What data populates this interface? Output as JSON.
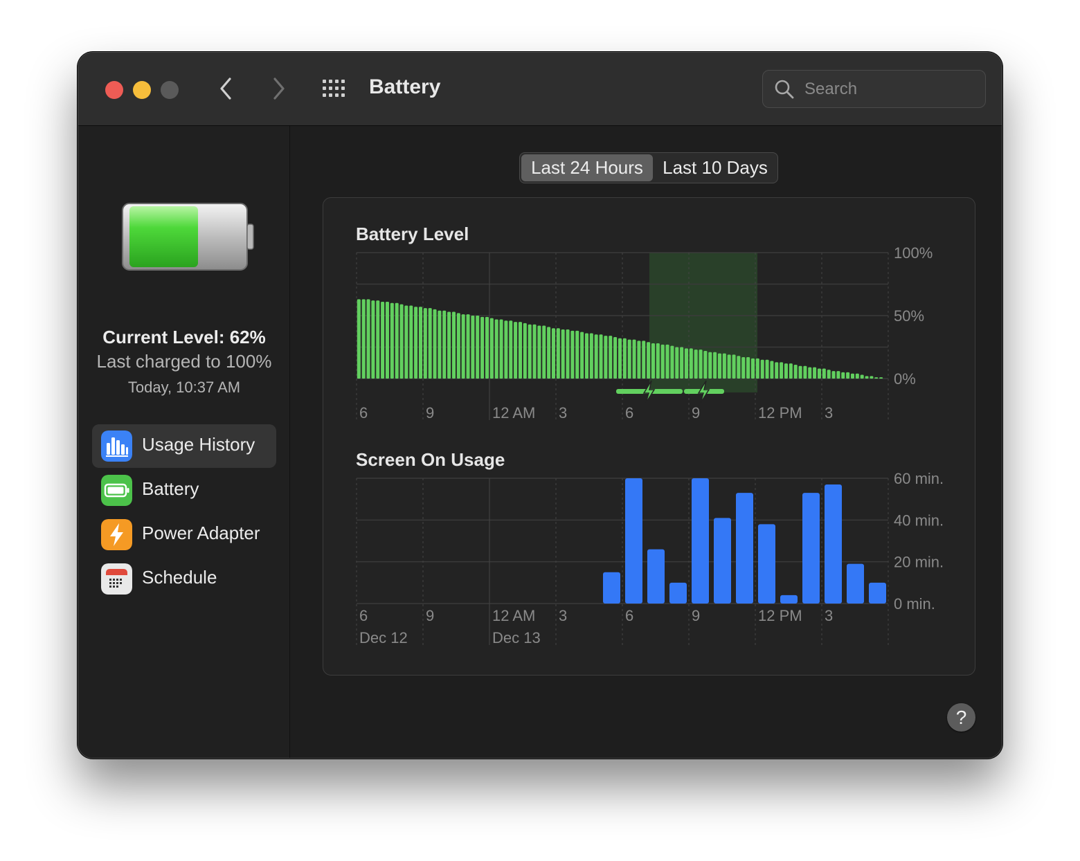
{
  "window": {
    "title": "Battery"
  },
  "search": {
    "placeholder": "Search"
  },
  "sidebar": {
    "current_level": "Current Level: 62%",
    "last_charged": "Last charged to 100%",
    "charged_time": "Today, 10:37 AM",
    "battery_fill": 0.62,
    "items": [
      {
        "label": "Usage History",
        "icon": "bar-chart-icon",
        "active": true
      },
      {
        "label": "Battery",
        "icon": "battery-icon",
        "active": false
      },
      {
        "label": "Power Adapter",
        "icon": "lightning-icon",
        "active": false
      },
      {
        "label": "Schedule",
        "icon": "calendar-icon",
        "active": false
      }
    ]
  },
  "segmented": {
    "options": [
      "Last 24 Hours",
      "Last 10 Days"
    ],
    "selected": "Last 24 Hours"
  },
  "colors": {
    "battery_bar": "#62d05f",
    "usage_bar": "#3478f6",
    "charging_band": "#2f5a30"
  },
  "help": {
    "label": "?"
  },
  "chart_data": [
    {
      "type": "bar",
      "title": "Battery Level",
      "y_ticks": [
        "100%",
        "50%",
        "0%"
      ],
      "ylim": [
        0,
        100
      ],
      "x_ticks": [
        "6",
        "9",
        "12 AM",
        "3",
        "6",
        "9",
        "12 PM",
        "3"
      ],
      "charging_periods": [
        [
          47,
          54
        ],
        [
          59,
          66
        ]
      ],
      "values": [
        63,
        63,
        63,
        63,
        62,
        62,
        62,
        61,
        61,
        61,
        61,
        60,
        60,
        60,
        59,
        59,
        59,
        58,
        58,
        58,
        57,
        57,
        57,
        56,
        56,
        56,
        55,
        55,
        55,
        54,
        54,
        54,
        53,
        53,
        53,
        52,
        52,
        52,
        51,
        51,
        51,
        50,
        50,
        50,
        49,
        49,
        49,
        48,
        48,
        48,
        47,
        47,
        47,
        46,
        46,
        46,
        45,
        45,
        45,
        44,
        44,
        44,
        43,
        43,
        43,
        42,
        42,
        42,
        41,
        41,
        41,
        40,
        40,
        40,
        39,
        39,
        39,
        38,
        38,
        38,
        37,
        37,
        37,
        36,
        36,
        36,
        35,
        35,
        35,
        34,
        34,
        34,
        33,
        33,
        33,
        32,
        32,
        32,
        31,
        31,
        31,
        30,
        30,
        30,
        29,
        29,
        29,
        28,
        28,
        28,
        27,
        27,
        27,
        26,
        26,
        26,
        25,
        25,
        25,
        24,
        24,
        24,
        23,
        23,
        23,
        22,
        22,
        22,
        21,
        21,
        21,
        20,
        20,
        20,
        19,
        19,
        19,
        18,
        18,
        18,
        17,
        17,
        17,
        16,
        16,
        16,
        15,
        15,
        15,
        14,
        14,
        14,
        13,
        13,
        13,
        12,
        12,
        12,
        11,
        11,
        11,
        10,
        10,
        10,
        9,
        9,
        9,
        8,
        8,
        8,
        7,
        7,
        7,
        6,
        6,
        6,
        5,
        5,
        5,
        4,
        4,
        4,
        3,
        3,
        3,
        2,
        2,
        2,
        1,
        1,
        1,
        0,
        0,
        0
      ]
    },
    {
      "type": "bar",
      "title": "Screen On Usage",
      "y_ticks": [
        "60 min.",
        "40 min.",
        "20 min.",
        "0 min."
      ],
      "ylim": [
        0,
        60
      ],
      "x_ticks": [
        "6",
        "9",
        "12 AM",
        "3",
        "6",
        "9",
        "12 PM",
        "3"
      ],
      "date_labels": [
        "Dec 12",
        "Dec 13"
      ],
      "slot_count": 24,
      "values": [
        0,
        0,
        0,
        0,
        0,
        0,
        0,
        0,
        0,
        0,
        0,
        15,
        60,
        26,
        10,
        60,
        41,
        53,
        38,
        4,
        53,
        57,
        19,
        10
      ]
    }
  ]
}
